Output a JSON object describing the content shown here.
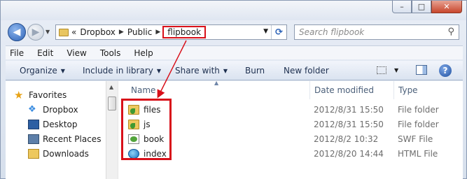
{
  "window": {
    "caption_buttons": [
      "minimize",
      "maximize",
      "close"
    ]
  },
  "address": {
    "crumbs": [
      "«",
      "Dropbox",
      "Public",
      "flipbook"
    ],
    "highlighted_crumb": "flipbook"
  },
  "search": {
    "placeholder": "Search flipbook"
  },
  "menu": {
    "items": [
      "File",
      "Edit",
      "View",
      "Tools",
      "Help"
    ]
  },
  "commands": {
    "organize": "Organize",
    "include_in_library": "Include in library",
    "share_with": "Share with",
    "burn": "Burn",
    "new_folder": "New folder"
  },
  "navpane": {
    "favorites_label": "Favorites",
    "items": [
      "Dropbox",
      "Desktop",
      "Recent Places",
      "Downloads"
    ]
  },
  "filelist": {
    "columns": [
      "Name",
      "Date modified",
      "Type"
    ],
    "rows": [
      {
        "name": "files",
        "date": "2012/8/31 15:50",
        "type": "File folder",
        "icon": "folder-icon"
      },
      {
        "name": "js",
        "date": "2012/8/31 15:50",
        "type": "File folder",
        "icon": "folder-icon"
      },
      {
        "name": "book",
        "date": "2012/8/2 10:32",
        "type": "SWF File",
        "icon": "swf-file-icon"
      },
      {
        "name": "index",
        "date": "2012/8/20 14:44",
        "type": "HTML File",
        "icon": "html-file-icon"
      }
    ]
  },
  "colors": {
    "annotation_red": "#d8101a",
    "accent_blue": "#2d63b7"
  }
}
